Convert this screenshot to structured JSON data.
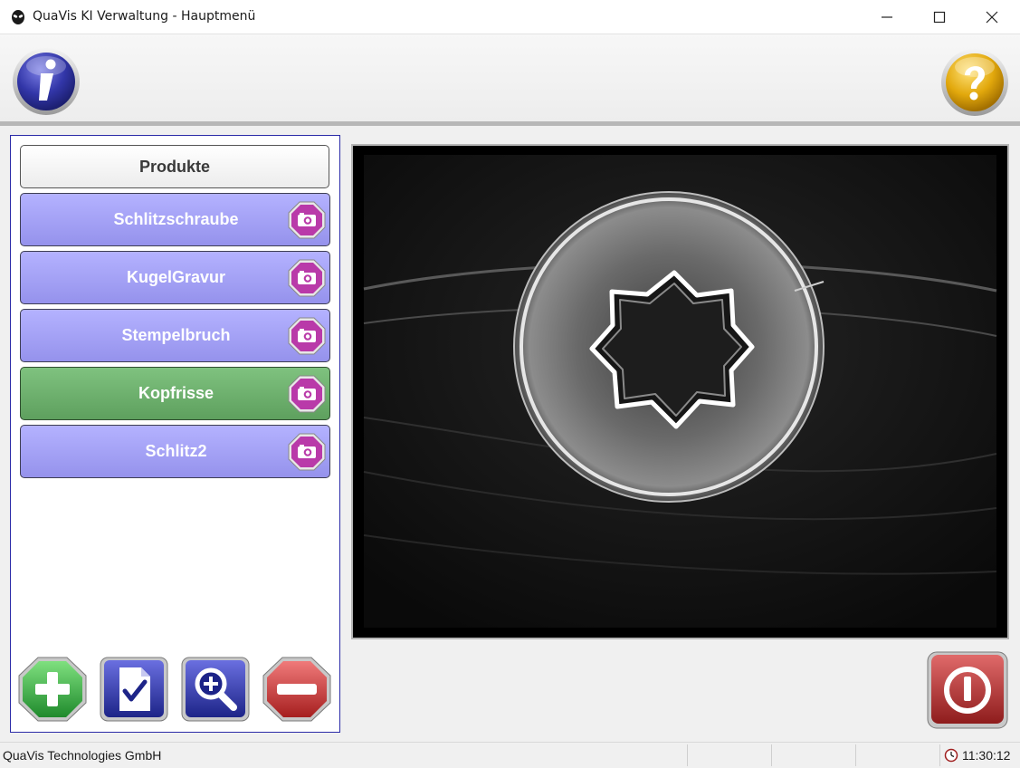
{
  "window": {
    "title": "QuaVis KI Verwaltung - Hauptmenü",
    "controls": [
      "minimize-icon",
      "maximize-icon",
      "close-icon"
    ]
  },
  "toolbar": {
    "info_icon": "info-icon",
    "help_icon": "help-icon"
  },
  "product_list": {
    "header": "Produkte",
    "items": [
      {
        "label": "Schlitzschraube",
        "selected": false
      },
      {
        "label": "KugelGravur",
        "selected": false
      },
      {
        "label": "Stempelbruch",
        "selected": false
      },
      {
        "label": "Kopfrisse",
        "selected": true
      },
      {
        "label": "Schlitz2",
        "selected": false
      }
    ],
    "actions": [
      "add-icon",
      "checklist-icon",
      "zoom-in-icon",
      "remove-icon"
    ]
  },
  "viewer": {
    "content": "torx-screw-head-image"
  },
  "statusbar": {
    "company": "QuaVis Technologies GmbH",
    "time": "11:30:12"
  },
  "colors": {
    "product_item": "#9f9cf5",
    "product_selected": "#6fb26f",
    "camera_button": "#b93aa9",
    "add_button": "#3fae3f",
    "remove_button": "#c53a3a",
    "power_button": "#b32d2d",
    "info_button": "#2d2fa0",
    "help_button": "#e0a50a"
  }
}
